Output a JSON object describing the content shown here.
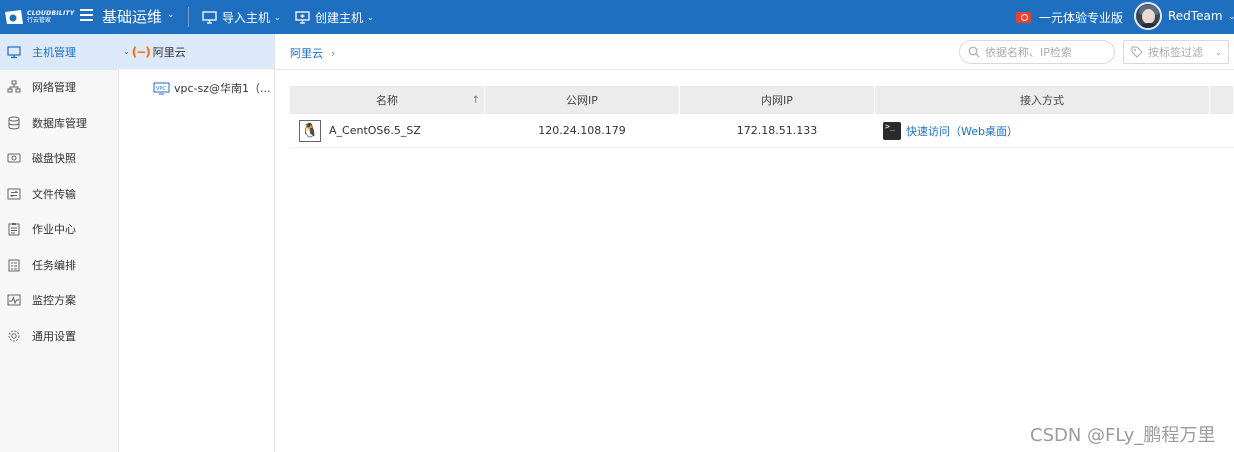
{
  "header": {
    "logo": {
      "brand": "CLOUDBILITY",
      "sub": "行云管家"
    },
    "module_title": "基础运维",
    "actions": [
      {
        "label": "导入主机",
        "icon": "monitor-import-icon"
      },
      {
        "label": "创建主机",
        "icon": "monitor-create-icon"
      }
    ],
    "promo_label": "一元体验专业版",
    "user_name": "RedTeam"
  },
  "sidebar": {
    "items": [
      {
        "label": "主机管理",
        "icon": "monitor-icon",
        "active": true
      },
      {
        "label": "网络管理",
        "icon": "network-icon"
      },
      {
        "label": "数据库管理",
        "icon": "database-icon"
      },
      {
        "label": "磁盘快照",
        "icon": "disk-snapshot-icon"
      },
      {
        "label": "文件传输",
        "icon": "file-transfer-icon"
      },
      {
        "label": "作业中心",
        "icon": "job-center-icon"
      },
      {
        "label": "任务编排",
        "icon": "task-orchestration-icon"
      },
      {
        "label": "监控方案",
        "icon": "monitor-plan-icon"
      },
      {
        "label": "通用设置",
        "icon": "settings-gear-icon"
      }
    ]
  },
  "tree": {
    "root_label": "阿里云",
    "child_label": "vpc-sz@华南1（..."
  },
  "content": {
    "breadcrumb": "阿里云",
    "search_placeholder": "依据名称、IP检索",
    "tag_filter_placeholder": "按标签过滤",
    "table": {
      "columns": [
        "名称",
        "公网IP",
        "内网IP",
        "接入方式"
      ],
      "rows": [
        {
          "name": "A_CentOS6.5_SZ",
          "public_ip": "120.24.108.179",
          "private_ip": "172.18.51.133",
          "access": "快速访问（Web桌面）"
        }
      ]
    }
  },
  "watermark": "CSDN @FLy_鹏程万里",
  "colors": {
    "header_bg": "#1e6fc0",
    "active_bg": "#dbe9fb",
    "link": "#1e6fc0",
    "aliyun_orange": "#ff6a00"
  }
}
